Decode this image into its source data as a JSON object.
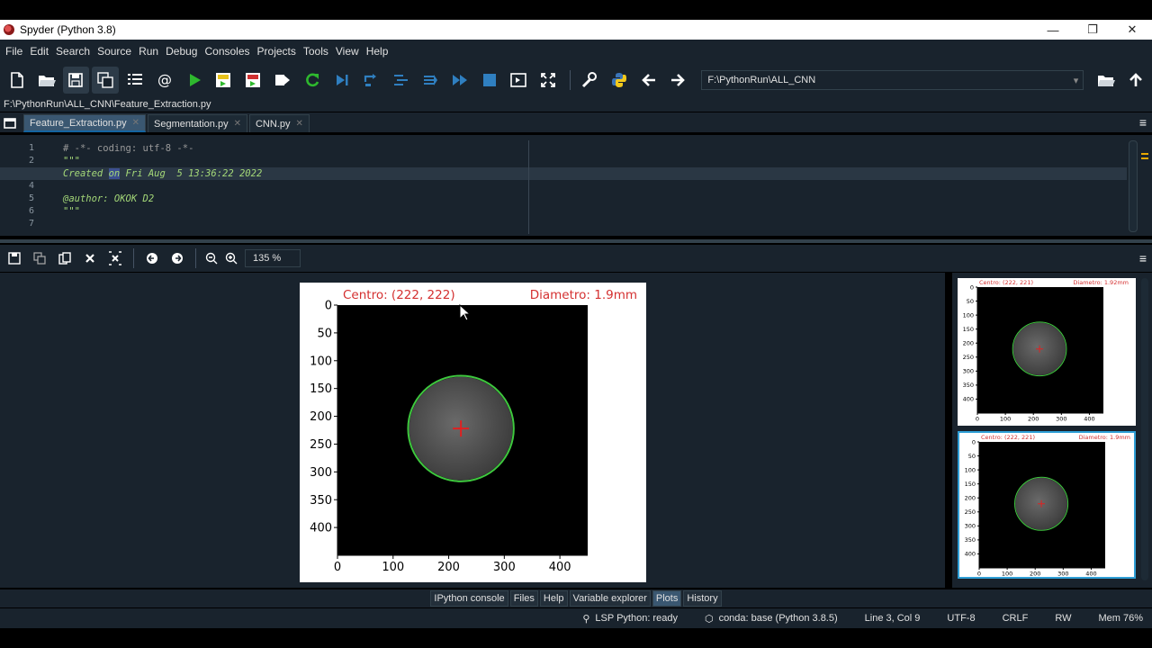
{
  "window": {
    "title": "Spyder (Python 3.8)",
    "minimize": "—",
    "restore": "❐",
    "close": "✕"
  },
  "menu": [
    "File",
    "Edit",
    "Search",
    "Source",
    "Run",
    "Debug",
    "Consoles",
    "Projects",
    "Tools",
    "View",
    "Help"
  ],
  "toolbar": {
    "icons": [
      "new-file-icon",
      "open-file-icon",
      "save-icon",
      "save-all-icon",
      "outline-icon",
      "at-icon",
      "run-icon",
      "run-cell-icon",
      "run-cell-advance-icon",
      "run-selection-icon",
      "rerun-icon",
      "step-icon",
      "step-into-icon",
      "step-return-icon",
      "continue-icon",
      "stop-icon",
      "maximize-pane-icon",
      "fullscreen-icon",
      "preferences-icon",
      "python-path-icon",
      "back-icon",
      "forward-icon"
    ],
    "working_dir": "F:\\PythonRun\\ALL_CNN"
  },
  "file_path": "F:\\PythonRun\\ALL_CNN\\Feature_Extraction.py",
  "editor": {
    "tabs": [
      {
        "label": "Feature_Extraction.py",
        "active": true
      },
      {
        "label": "Segmentation.py",
        "active": false
      },
      {
        "label": "CNN.py",
        "active": false
      }
    ],
    "line_numbers": [
      "1",
      "2",
      "3",
      "4",
      "5",
      "6",
      "7"
    ],
    "current_line": 3,
    "lines": {
      "l1": "# -*- coding: utf-8 -*-",
      "l2": "\"\"\"",
      "l3a": "Created ",
      "l3b": "on",
      "l3c": " Fri Aug  5 13:36:22 2022",
      "l4": "",
      "l5": "@author: OKOK D2",
      "l6": "\"\"\"",
      "l7": ""
    }
  },
  "plots_toolbar": {
    "icons": [
      "save-plot-icon",
      "save-all-plots-icon",
      "copy-plot-icon",
      "remove-plot-icon",
      "remove-all-plots-icon",
      "previous-plot-icon",
      "next-plot-icon",
      "zoom-out-icon",
      "zoom-in-icon"
    ],
    "zoom": "135 %"
  },
  "chart_data": [
    {
      "type": "scatter",
      "title_left": "Centro: (222, 222)",
      "title_right": "Diametro: 1.9mm",
      "x_ticks": [
        "0",
        "100",
        "200",
        "300",
        "400"
      ],
      "y_ticks": [
        "0",
        "50",
        "100",
        "150",
        "200",
        "250",
        "300",
        "350",
        "400"
      ],
      "xlim": [
        0,
        450
      ],
      "ylim": [
        450,
        0
      ],
      "center": [
        222,
        222
      ],
      "circle_radius": 95,
      "colors": {
        "circle": "#3ec83e",
        "marker": "#e02020",
        "title": "#d43030"
      }
    },
    {
      "type": "scatter",
      "title_left": "Centro: (222, 221)",
      "title_right": "Diametro: 1.92mm",
      "x_ticks": [
        "0",
        "100",
        "200",
        "300",
        "400"
      ],
      "y_ticks": [
        "0",
        "50",
        "100",
        "150",
        "200",
        "250",
        "300",
        "350",
        "400"
      ],
      "xlim": [
        0,
        450
      ],
      "ylim": [
        450,
        0
      ],
      "center": [
        222,
        221
      ],
      "circle_radius": 96
    },
    {
      "type": "scatter",
      "title_left": "Centro: (222, 221)",
      "title_right": "Diametro: 1.9mm",
      "x_ticks": [
        "0",
        "100",
        "200",
        "300",
        "400"
      ],
      "y_ticks": [
        "0",
        "50",
        "100",
        "150",
        "200",
        "250",
        "300",
        "350",
        "400"
      ],
      "xlim": [
        0,
        450
      ],
      "ylim": [
        450,
        0
      ],
      "center": [
        222,
        221
      ],
      "circle_radius": 95
    }
  ],
  "pane_tabs": [
    {
      "label": "IPython console",
      "active": false
    },
    {
      "label": "Files",
      "active": false
    },
    {
      "label": "Help",
      "active": false
    },
    {
      "label": "Variable explorer",
      "active": false
    },
    {
      "label": "Plots",
      "active": true
    },
    {
      "label": "History",
      "active": false
    }
  ],
  "status": {
    "lsp": "LSP Python: ready",
    "conda": "conda: base (Python 3.8.5)",
    "cursor": "Line 3, Col 9",
    "encoding": "UTF-8",
    "eol": "CRLF",
    "perm": "RW",
    "mem": "Mem 76%"
  }
}
